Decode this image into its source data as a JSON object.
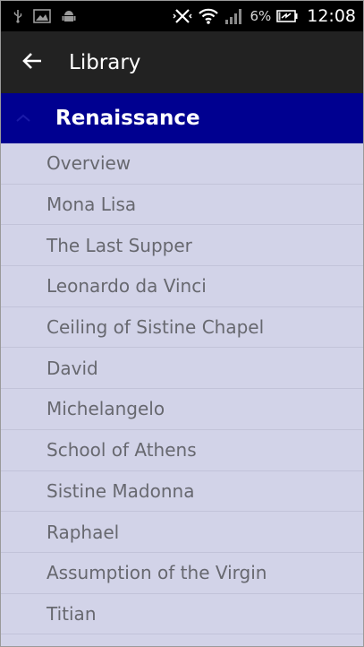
{
  "status_bar": {
    "battery_percent": "6%",
    "time": "12:08",
    "icons": [
      "usb-icon",
      "image-icon",
      "android-icon",
      "vibrate-icon",
      "wifi-icon",
      "signal-icon",
      "battery-icon"
    ]
  },
  "action_bar": {
    "title": "Library",
    "back_icon": "arrow-left-icon"
  },
  "group": {
    "title": "Renaissance",
    "expanded": true
  },
  "items": [
    {
      "label": "Overview"
    },
    {
      "label": "Mona Lisa"
    },
    {
      "label": "The Last Supper"
    },
    {
      "label": "Leonardo da Vinci"
    },
    {
      "label": "Ceiling of Sistine Chapel"
    },
    {
      "label": "David"
    },
    {
      "label": "Michelangelo"
    },
    {
      "label": "School of Athens"
    },
    {
      "label": "Sistine Madonna"
    },
    {
      "label": "Raphael"
    },
    {
      "label": "Assumption of the Virgin"
    },
    {
      "label": "Titian"
    }
  ],
  "colors": {
    "status_bar": "#000000",
    "action_bar": "#222222",
    "group_header": "#000090",
    "list_background": "#d2d3e8",
    "item_text": "#67686f"
  }
}
